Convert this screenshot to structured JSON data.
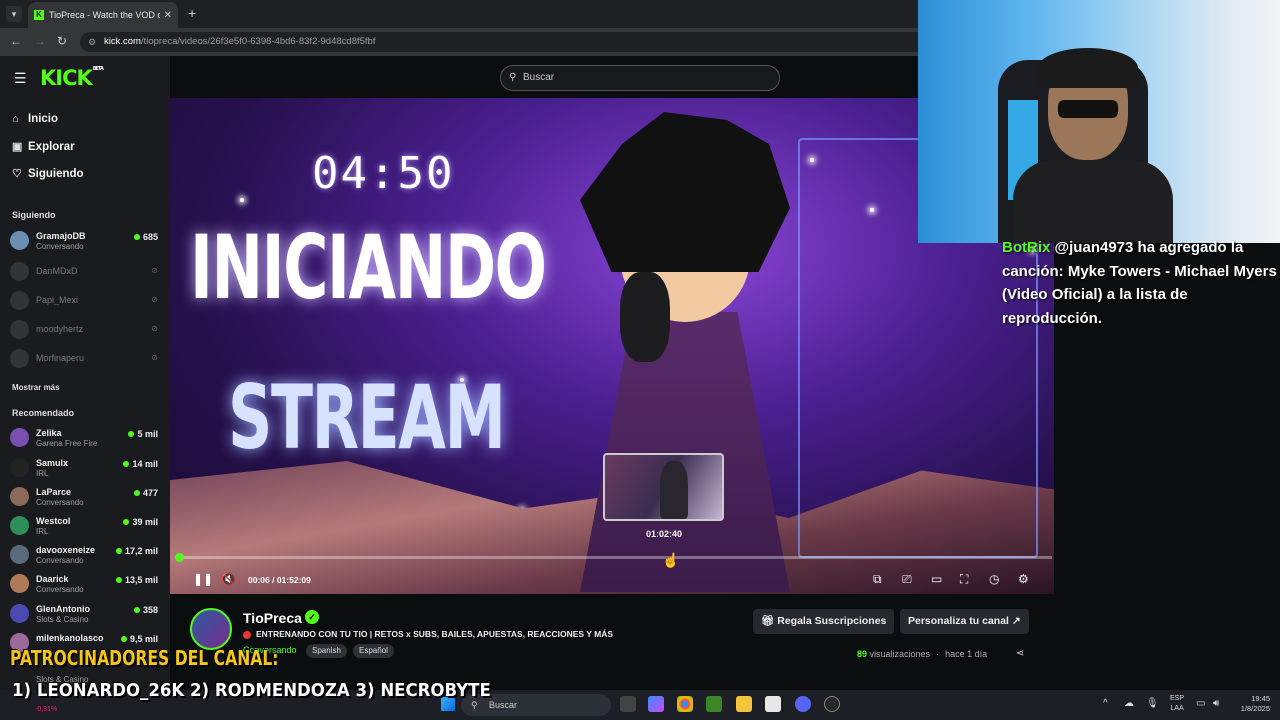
{
  "browser": {
    "tab_title": "TioPreca - Watch the VOD on Kick",
    "url_host": "kick.com",
    "url_path": "/tiopreca/videos/26f3e5f0-6398-4bd6-83f2-9d48cd8f5fbf"
  },
  "kick": {
    "logo": "KICK",
    "logo_beta": "BETA",
    "search_placeholder": "Buscar",
    "nav": [
      {
        "label": "Inicio",
        "icon": "home-icon"
      },
      {
        "label": "Explorar",
        "icon": "compass-icon"
      },
      {
        "label": "Siguiendo",
        "icon": "heart-icon"
      }
    ],
    "following_header": "Siguiendo",
    "following": [
      {
        "name": "GramajoDB",
        "sub": "Conversando",
        "viewers": "685",
        "live": true
      },
      {
        "name": "DanMDxD",
        "live": false
      },
      {
        "name": "Papi_Mexi",
        "live": false
      },
      {
        "name": "moodyhertz",
        "live": false
      },
      {
        "name": "Morfinaperu",
        "live": false
      }
    ],
    "show_more": "Mostrar más",
    "recommended_header": "Recomendado",
    "recommended": [
      {
        "name": "Zelika",
        "sub": "Garena Free Fire",
        "viewers": "5 mil"
      },
      {
        "name": "Samulx",
        "sub": "IRL",
        "viewers": "14 mil"
      },
      {
        "name": "LaParce",
        "sub": "Conversando",
        "viewers": "477"
      },
      {
        "name": "Westcol",
        "sub": "IRL",
        "viewers": "39 mil"
      },
      {
        "name": "davooxeneize",
        "sub": "Conversando",
        "viewers": "17,2 mil"
      },
      {
        "name": "Daarick",
        "sub": "Conversando",
        "viewers": "13,5 mil"
      },
      {
        "name": "GlenAntonio",
        "sub": "Slots & Casino",
        "viewers": "358"
      },
      {
        "name": "milenkanolasco",
        "sub": "",
        "viewers": "9,5 mil"
      }
    ]
  },
  "video": {
    "timer_text": "04:50",
    "line1": "INICIANDO",
    "line2": "STREAM",
    "time_display": "00:06 / 01:52:09",
    "hover_time": "01:02:40",
    "progress_fraction": 0.003
  },
  "channel": {
    "name": "TioPreca",
    "stream_title": "ENTRENANDO CON TU TIO | RETOS x SUBS, BAILES, APUESTAS, REACCIONES Y MÁS",
    "category": "Conversando",
    "tags": [
      "Spanish",
      "Español"
    ],
    "gift_button": "Regala Suscripciones",
    "customize_button": "Personaliza tu canal",
    "views_count": "89",
    "views_label": "visualizaciones",
    "age": "hace 1 día"
  },
  "overlay": {
    "chat_bot": "BotRix",
    "chat_user": "@juan4973",
    "chat_text": "ha agregado la canción: Myke Towers - Michael Myers (Video Oficial) a la lista de reproducción.",
    "sponsors_title": "PATROCINADORES DEL CANAL:",
    "sponsors_list": "1) LEONARDO_26K 2) RODMENDOZA 3) NECROBYTE",
    "partial_slots": "Slots & Casino",
    "stock_change": "-0,31%"
  },
  "taskbar": {
    "search_placeholder": "Buscar",
    "lang_top": "ESP",
    "lang_bottom": "LAA",
    "time": "19:45",
    "date": "1/8/2025"
  },
  "colors": {
    "accent": "#53fc18"
  }
}
